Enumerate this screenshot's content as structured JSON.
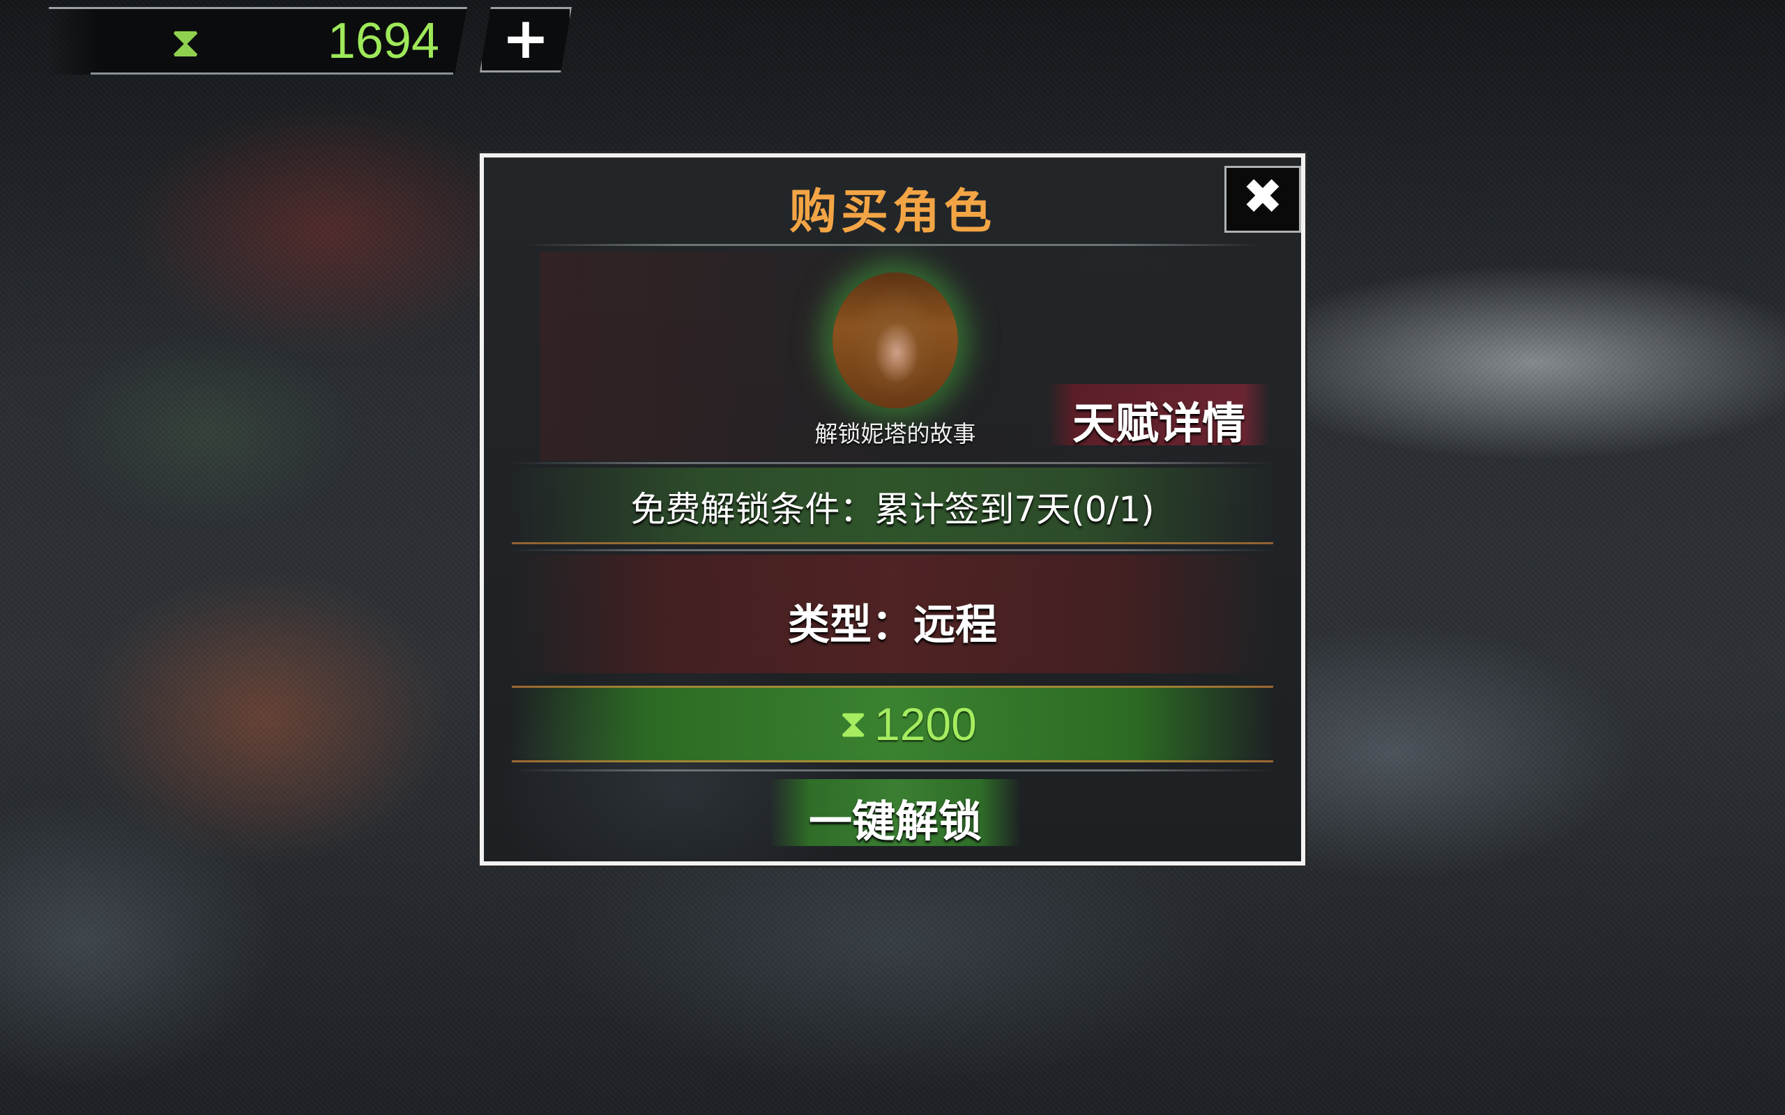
{
  "currency": {
    "icon": "hourglass-icon",
    "icon_glyph": "⧗",
    "value": "1694",
    "add_glyph": "+"
  },
  "dialog": {
    "title": "购买角色",
    "close_glyph": "✖",
    "character": {
      "avatar": "character-portrait",
      "caption": "解锁妮塔的故事"
    },
    "talent_label": "天赋详情",
    "condition": "免费解锁条件：累计签到7天(0/1)",
    "type": "类型：远程",
    "price": {
      "icon": "hourglass-icon",
      "icon_glyph": "⧗",
      "value": "1200"
    },
    "unlock_label": "一键解锁"
  },
  "colors": {
    "title": "#f3a545",
    "currency_text": "#9ee85a",
    "price_band": "#3a8230",
    "talent_button": "#6a2531"
  }
}
